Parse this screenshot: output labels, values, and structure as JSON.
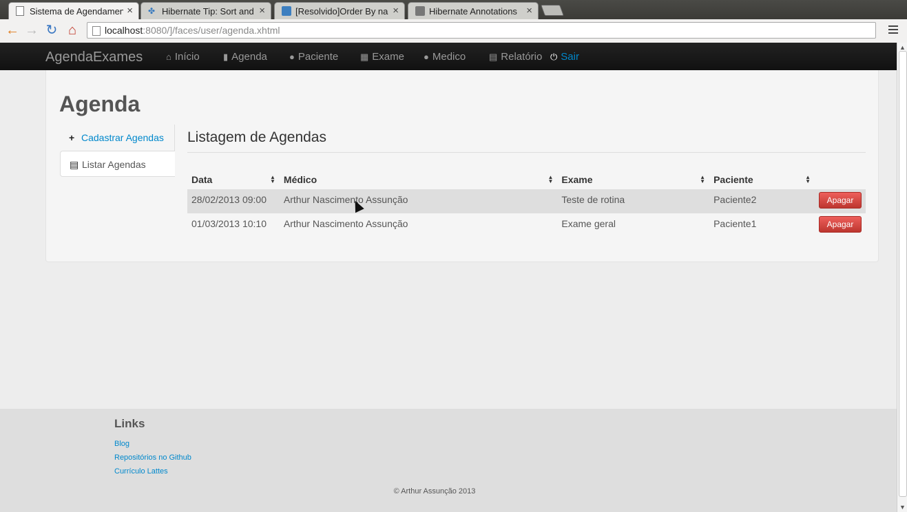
{
  "browser": {
    "tabs": [
      {
        "title": "Sistema de Agendamento",
        "active": true
      },
      {
        "title": "Hibernate Tip: Sort and O",
        "active": false
      },
      {
        "title": "[Resolvido]Order By na a",
        "active": false
      },
      {
        "title": "Hibernate Annotations",
        "active": false
      }
    ],
    "close_glyph": "×",
    "url_host": "localhost",
    "url_rest": ":8080/]/faces/user/agenda.xhtml"
  },
  "navbar": {
    "brand": "AgendaExames",
    "items": [
      {
        "label": "Início",
        "icon": "home-icon"
      },
      {
        "label": "Agenda",
        "icon": "book-icon"
      },
      {
        "label": "Paciente",
        "icon": "user-icon"
      },
      {
        "label": "Exame",
        "icon": "calendar-icon"
      },
      {
        "label": "Medico",
        "icon": "user-icon"
      },
      {
        "label": "Relatório",
        "icon": "list-icon"
      },
      {
        "label": "Sair",
        "icon": "power-icon"
      }
    ]
  },
  "page": {
    "title": "Agenda",
    "side_nav": [
      {
        "label": "Cadastrar Agendas",
        "icon": "plus-icon"
      },
      {
        "label": "Listar Agendas",
        "icon": "list-icon"
      }
    ],
    "list_title": "Listagem de Agendas"
  },
  "table": {
    "headers": [
      "Data",
      "Médico",
      "Exame",
      "Paciente"
    ],
    "rows": [
      {
        "data": "28/02/2013 09:00",
        "medico": "Arthur Nascimento Assunção",
        "exame": "Teste de rotina",
        "paciente": "Paciente2",
        "action": "Apagar"
      },
      {
        "data": "01/03/2013 10:10",
        "medico": "Arthur Nascimento Assunção",
        "exame": "Exame geral",
        "paciente": "Paciente1",
        "action": "Apagar"
      }
    ]
  },
  "footer": {
    "links_title": "Links",
    "links": [
      "Blog",
      "Repositórios no Github",
      "Currículo Lattes"
    ],
    "copyright": "© Arthur Assunção 2013"
  },
  "colors": {
    "accent": "#0088cc",
    "danger": "#da4f49",
    "navbar": "#1b1b1b"
  }
}
